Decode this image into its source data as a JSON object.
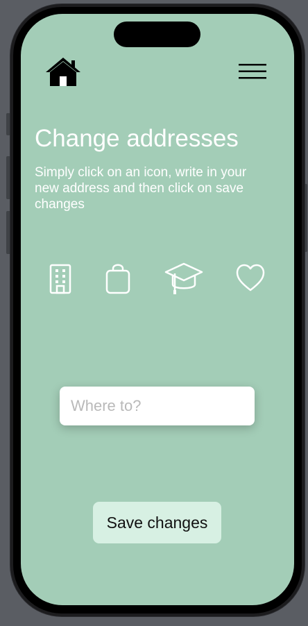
{
  "header": {
    "home_icon": "house-icon",
    "menu_icon": "hamburger-menu-icon"
  },
  "main": {
    "title": "Change addresses",
    "subtitle": "Simply click on an icon, write in your new address and then click on save changes"
  },
  "address_icons": [
    "building-icon",
    "shopping-bag-icon",
    "graduation-cap-icon",
    "heart-icon"
  ],
  "search": {
    "placeholder": "Where to?",
    "value": ""
  },
  "actions": {
    "save_label": "Save changes"
  },
  "colors": {
    "screen_background": "#a3cdb7",
    "button_background": "#d7f0e3",
    "text": "#ffffff"
  }
}
